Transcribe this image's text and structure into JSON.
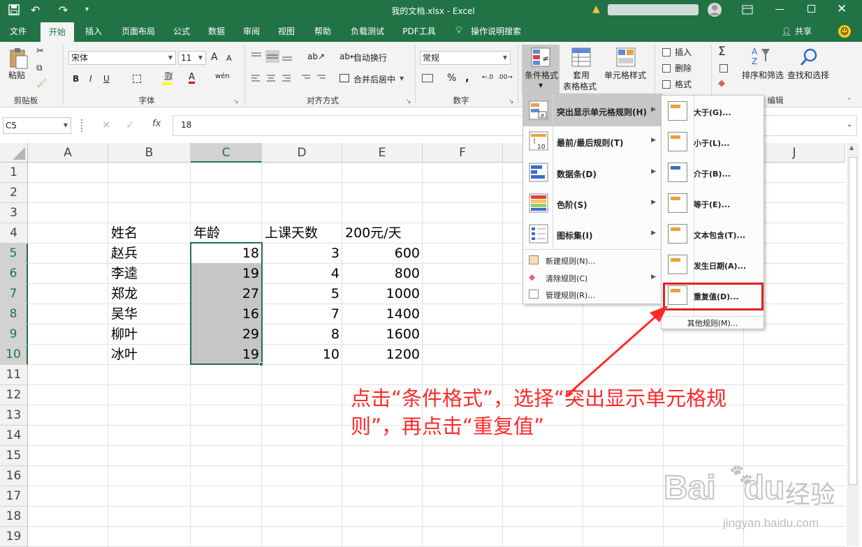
{
  "window": {
    "title": "我的文档.xlsx  -  Excel"
  },
  "tabs": [
    "文件",
    "开始",
    "插入",
    "页面布局",
    "公式",
    "数据",
    "审阅",
    "视图",
    "帮助",
    "负载测试",
    "PDF工具"
  ],
  "search_label": "操作说明搜索",
  "share_label": "共享",
  "ribbon": {
    "clipboard": {
      "paste": "粘贴",
      "label": "剪贴板"
    },
    "font": {
      "name": "宋体",
      "size": "11",
      "label": "字体",
      "bold": "B",
      "italic": "I",
      "underline": "U",
      "grow": "A",
      "shrink": "A",
      "phonetic": "wén"
    },
    "alignment": {
      "wrap": "自动换行",
      "merge": "合并后居中",
      "label": "对齐方式"
    },
    "number": {
      "format": "常规",
      "label": "数字",
      "percent": "%",
      "comma": ","
    },
    "styles": {
      "cond_format": "条件格式",
      "table_format1": "套用",
      "table_format2": "表格格式",
      "cell_styles": "单元格样式"
    },
    "cells": {
      "insert": "插入",
      "delete": "删除",
      "format": "格式"
    },
    "editing": {
      "sort": "排序和筛选",
      "find": "查找和选择",
      "label": "编辑"
    }
  },
  "formula_bar": {
    "name_box": "C5",
    "value": "18",
    "fx": "fx"
  },
  "columns": [
    "A",
    "B",
    "C",
    "D",
    "E",
    "F",
    "G",
    "H",
    "I",
    "J"
  ],
  "rows": [
    "1",
    "2",
    "3",
    "4",
    "5",
    "6",
    "7",
    "8",
    "9",
    "10",
    "11",
    "12",
    "13",
    "14",
    "15",
    "16",
    "17",
    "18",
    "19"
  ],
  "table": {
    "headers": [
      "姓名",
      "年龄",
      "上课天数",
      "200元/天"
    ],
    "rows": [
      [
        "赵兵",
        "18",
        "3",
        "600"
      ],
      [
        "李逵",
        "19",
        "4",
        "800"
      ],
      [
        "郑龙",
        "27",
        "5",
        "1000"
      ],
      [
        "吴华",
        "16",
        "7",
        "1400"
      ],
      [
        "柳叶",
        "29",
        "8",
        "1600"
      ],
      [
        "冰叶",
        "19",
        "10",
        "1200"
      ]
    ]
  },
  "cf_menu": [
    "突出显示单元格规则(H)",
    "最前/最后规则(T)",
    "数据条(D)",
    "色阶(S)",
    "图标集(I)",
    "新建规则(N)...",
    "清除规则(C)",
    "管理规则(R)..."
  ],
  "sub_menu": [
    "大于(G)...",
    "小于(L)...",
    "介于(B)...",
    "等于(E)...",
    "文本包含(T)...",
    "发生日期(A)...",
    "重复值(D)...",
    "其他规则(M)..."
  ],
  "icon_labels": {
    "top10": "10"
  },
  "annotation": {
    "line1": "点击“条件格式”，选择“突出显示单元格规",
    "line2": "则”，再点击“重复值”"
  },
  "watermark": {
    "brand": "Bai",
    "brand2": "du",
    "cn": "经验",
    "url": "jingyan.baidu.com"
  },
  "colors": {
    "excel_green": "#217346",
    "highlight_red": "#ff2a2a",
    "selection_gray": "#c6c6c6"
  }
}
